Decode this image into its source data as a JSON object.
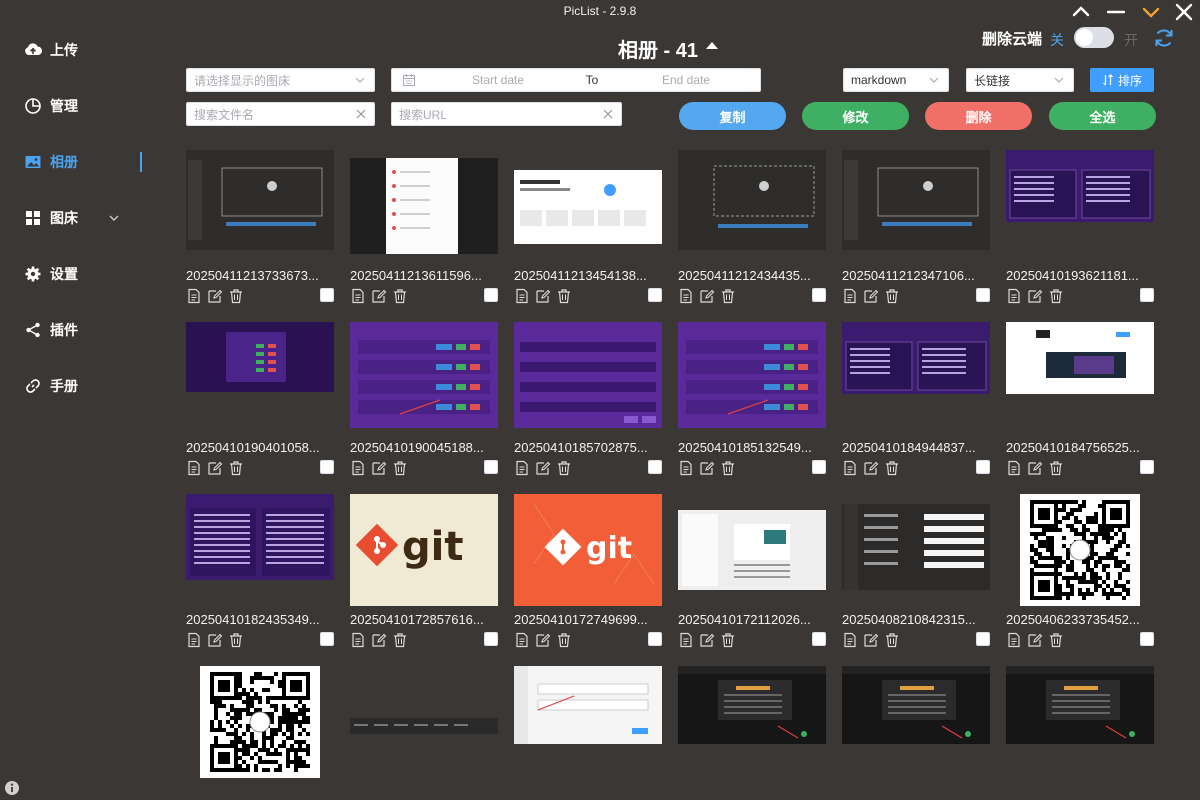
{
  "window": {
    "title": "PicList - 2.9.8",
    "controls": [
      {
        "name": "collapse-up-icon",
        "color": "#ffffff"
      },
      {
        "name": "minimize-icon",
        "color": "#ffffff"
      },
      {
        "name": "chevron-down-icon",
        "color": "#f0a030"
      },
      {
        "name": "close-icon",
        "color": "#ffffff"
      }
    ]
  },
  "sidebar": {
    "items": [
      {
        "label": "上传",
        "icon": "upload-cloud-icon"
      },
      {
        "label": "管理",
        "icon": "pie-chart-icon"
      },
      {
        "label": "相册",
        "icon": "image-icon",
        "active": true
      },
      {
        "label": "图床",
        "icon": "grid-icon",
        "has_caret": true
      },
      {
        "label": "设置",
        "icon": "gear-icon"
      },
      {
        "label": "插件",
        "icon": "share-icon"
      },
      {
        "label": "手册",
        "icon": "link-icon"
      }
    ],
    "accent": "#4aa3f0"
  },
  "header": {
    "album_title": "相册 - 41",
    "cloud_delete_label": "删除云端",
    "toggle_off_label": "关",
    "toggle_on_label": "开",
    "toggle_state": "off"
  },
  "filters": {
    "bed_placeholder": "请选择显示的图床",
    "date_start_placeholder": "Start date",
    "date_to": "To",
    "date_end_placeholder": "End date",
    "format_value": "markdown",
    "link_value": "长链接",
    "sort_label": "排序",
    "filename_placeholder": "搜索文件名",
    "url_placeholder": "搜索URL"
  },
  "actions": [
    {
      "label": "复制",
      "color": "#53a8f0"
    },
    {
      "label": "修改",
      "color": "#3fb063"
    },
    {
      "label": "删除",
      "color": "#f07068"
    },
    {
      "label": "全选",
      "color": "#3fb063"
    }
  ],
  "grid": {
    "items": [
      {
        "name": "20250411213733673...",
        "thumb": "upload-gray"
      },
      {
        "name": "20250411213611596...",
        "thumb": "menu-dark"
      },
      {
        "name": "20250411213454138...",
        "thumb": "webpage-white"
      },
      {
        "name": "20250411212434435...",
        "thumb": "upload-dashed"
      },
      {
        "name": "20250411212347106...",
        "thumb": "upload-gray"
      },
      {
        "name": "20250410193621181...",
        "thumb": "purple-panels"
      },
      {
        "name": "20250410190401058...",
        "thumb": "purple-dialog"
      },
      {
        "name": "20250410190045188...",
        "thumb": "purple-list"
      },
      {
        "name": "20250410185702875...",
        "thumb": "purple-form"
      },
      {
        "name": "20250410185132549...",
        "thumb": "purple-list"
      },
      {
        "name": "20250410184944837...",
        "thumb": "purple-panels"
      },
      {
        "name": "20250410184756525...",
        "thumb": "white-dialog"
      },
      {
        "name": "20250410182435349...",
        "thumb": "purple-text"
      },
      {
        "name": "20250410172857616...",
        "thumb": "git-beige"
      },
      {
        "name": "20250410172749699...",
        "thumb": "git-orange"
      },
      {
        "name": "20250410172112026...",
        "thumb": "webpage-light"
      },
      {
        "name": "20250408210842315...",
        "thumb": "settings-gray"
      },
      {
        "name": "20250406233735452...",
        "thumb": "qrcode"
      },
      {
        "name": "",
        "thumb": "qrcode"
      },
      {
        "name": "",
        "thumb": "thin-strip"
      },
      {
        "name": "",
        "thumb": "webpage-form"
      },
      {
        "name": "",
        "thumb": "dark-app"
      },
      {
        "name": "",
        "thumb": "dark-app"
      },
      {
        "name": "",
        "thumb": "dark-app"
      }
    ]
  }
}
